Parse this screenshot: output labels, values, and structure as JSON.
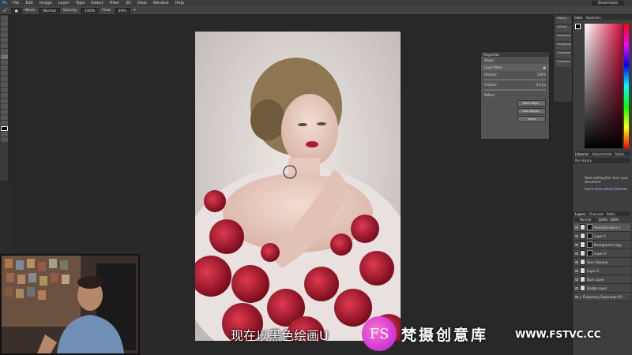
{
  "app": {
    "logo": "Ps"
  },
  "menu": [
    "File",
    "Edit",
    "Image",
    "Layer",
    "Type",
    "Select",
    "Filter",
    "3D",
    "View",
    "Window",
    "Help"
  ],
  "workspace_label": "Essentials",
  "options": {
    "mode_label": "Mode:",
    "mode_value": "Normal",
    "opacity_label": "Opacity:",
    "opacity_value": "100%",
    "flow_label": "Flow:",
    "flow_value": "30%"
  },
  "properties": {
    "title": "Properties",
    "section": "Masks",
    "mask_type": "Layer Mask",
    "density_label": "Density:",
    "density_value": "100%",
    "feather_label": "Feather:",
    "feather_value": "0.0 px",
    "refine_label": "Refine:",
    "buttons": [
      "Mask Edge...",
      "Color Range...",
      "Invert"
    ]
  },
  "right_strip": [
    "History",
    "Actions",
    "Swatches",
    "Paragraph",
    "Character",
    "Channels"
  ],
  "panels": {
    "color_tabs": [
      "Color",
      "Swatches"
    ],
    "library_tabs": [
      "Libraries",
      "Adjustments",
      "Styles"
    ],
    "library_name": "My Library",
    "library_msg": "Start adding files from your document",
    "library_link": "Learn more about Libraries",
    "layers_tabs": [
      "Layers",
      "Channels",
      "Paths"
    ],
    "blend_mode": "Normal",
    "opacity": "100%",
    "fill": "100%"
  },
  "layers": [
    {
      "name": "Hue/Saturation 1",
      "selected": true
    },
    {
      "name": "Layer 5",
      "selected": false
    },
    {
      "name": "Background copy",
      "selected": false
    },
    {
      "name": "Layer 4",
      "selected": false
    },
    {
      "name": "Skin Cleanup",
      "selected": false
    },
    {
      "name": "Layer 3",
      "selected": false
    },
    {
      "name": "Burn Layer",
      "selected": false
    },
    {
      "name": "Dodge Layer",
      "selected": false
    },
    {
      "name": "Frequency Separation Bl...",
      "selected": false
    }
  ],
  "subtitle": "现在以黑色绘画U",
  "watermark": {
    "logo": "FS",
    "text": "梵摄创意库",
    "url": "WWW.FSTVC.CC"
  }
}
